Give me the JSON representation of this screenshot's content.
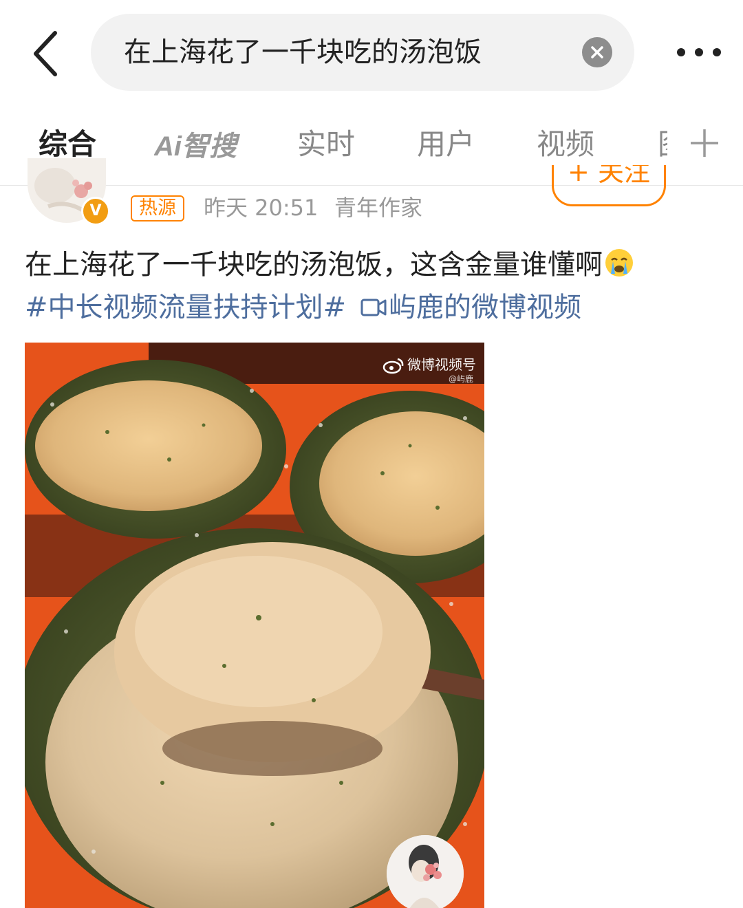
{
  "search": {
    "query": "在上海花了一千块吃的汤泡饭"
  },
  "tabs": [
    {
      "label": "综合",
      "active": true
    },
    {
      "label": "Ai智搜",
      "active": false
    },
    {
      "label": "实时",
      "active": false
    },
    {
      "label": "用户",
      "active": false
    },
    {
      "label": "视频",
      "active": false
    },
    {
      "label": "图",
      "active": false
    }
  ],
  "colors": {
    "accent": "#ff8200",
    "link": "#4e6e9e",
    "muted": "#999999",
    "verified_badge": "#f29d12"
  },
  "post": {
    "follow_label": "+ 关注",
    "hot_tag": "热源",
    "time": "昨天 20:51",
    "source": "青年作家",
    "text": "在上海花了一千块吃的汤泡饭，这含金量谁懂啊",
    "emoji": "crying-face-icon",
    "topic": "#中长视频流量扶持计划#",
    "video_link": "屿鹿的微博视频",
    "media": {
      "watermark": "微博视频号",
      "watermark_handle": "@屿鹿"
    }
  }
}
